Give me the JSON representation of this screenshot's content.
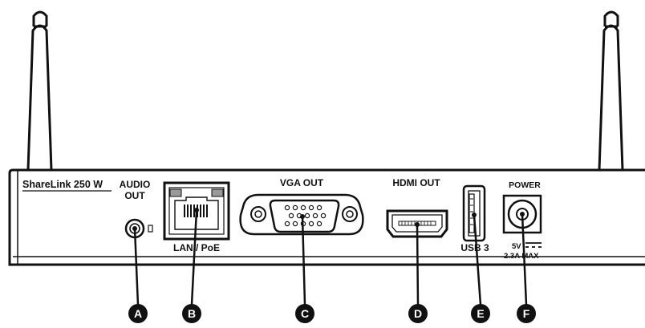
{
  "device": {
    "model": "ShareLink 250 W"
  },
  "ports": {
    "audio": {
      "label_line1": "AUDIO",
      "label_line2": "OUT"
    },
    "lan": {
      "label": "LAN / PoE"
    },
    "vga": {
      "label": "VGA OUT"
    },
    "hdmi": {
      "label": "HDMI OUT"
    },
    "usb": {
      "label": "USB 3"
    },
    "power": {
      "label": "POWER",
      "spec_line1": "5V",
      "spec_line2": "2.3A MAX"
    }
  },
  "callouts": [
    {
      "letter": "A",
      "target": "audio"
    },
    {
      "letter": "B",
      "target": "lan"
    },
    {
      "letter": "C",
      "target": "vga"
    },
    {
      "letter": "D",
      "target": "hdmi"
    },
    {
      "letter": "E",
      "target": "usb"
    },
    {
      "letter": "F",
      "target": "power"
    }
  ],
  "colors": {
    "line": "#111111",
    "callout_fill": "#111111",
    "callout_text": "#ffffff",
    "port_grey": "#9a9a9a"
  }
}
